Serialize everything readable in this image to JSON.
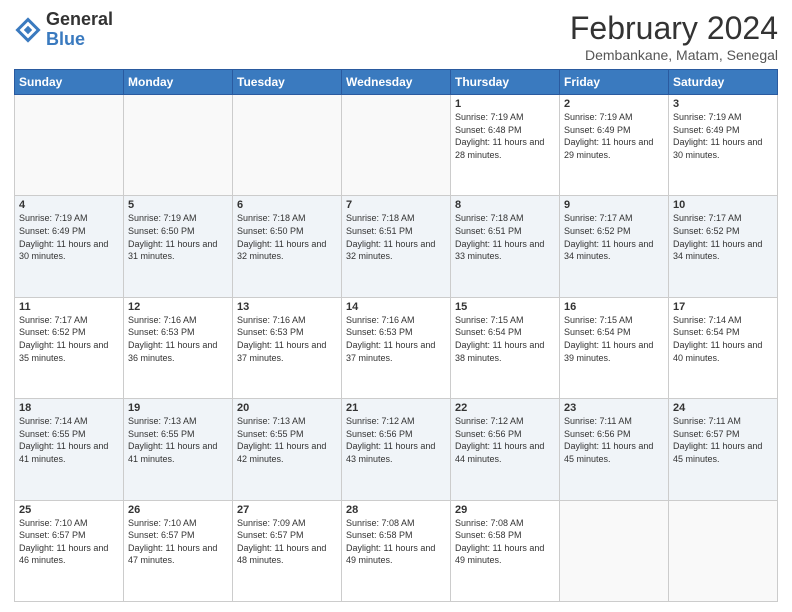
{
  "logo": {
    "general": "General",
    "blue": "Blue"
  },
  "header": {
    "month_title": "February 2024",
    "location": "Dembankane, Matam, Senegal"
  },
  "days_of_week": [
    "Sunday",
    "Monday",
    "Tuesday",
    "Wednesday",
    "Thursday",
    "Friday",
    "Saturday"
  ],
  "weeks": [
    [
      {
        "day": "",
        "info": ""
      },
      {
        "day": "",
        "info": ""
      },
      {
        "day": "",
        "info": ""
      },
      {
        "day": "",
        "info": ""
      },
      {
        "day": "1",
        "info": "Sunrise: 7:19 AM\nSunset: 6:48 PM\nDaylight: 11 hours and 28 minutes."
      },
      {
        "day": "2",
        "info": "Sunrise: 7:19 AM\nSunset: 6:49 PM\nDaylight: 11 hours and 29 minutes."
      },
      {
        "day": "3",
        "info": "Sunrise: 7:19 AM\nSunset: 6:49 PM\nDaylight: 11 hours and 30 minutes."
      }
    ],
    [
      {
        "day": "4",
        "info": "Sunrise: 7:19 AM\nSunset: 6:49 PM\nDaylight: 11 hours and 30 minutes."
      },
      {
        "day": "5",
        "info": "Sunrise: 7:19 AM\nSunset: 6:50 PM\nDaylight: 11 hours and 31 minutes."
      },
      {
        "day": "6",
        "info": "Sunrise: 7:18 AM\nSunset: 6:50 PM\nDaylight: 11 hours and 32 minutes."
      },
      {
        "day": "7",
        "info": "Sunrise: 7:18 AM\nSunset: 6:51 PM\nDaylight: 11 hours and 32 minutes."
      },
      {
        "day": "8",
        "info": "Sunrise: 7:18 AM\nSunset: 6:51 PM\nDaylight: 11 hours and 33 minutes."
      },
      {
        "day": "9",
        "info": "Sunrise: 7:17 AM\nSunset: 6:52 PM\nDaylight: 11 hours and 34 minutes."
      },
      {
        "day": "10",
        "info": "Sunrise: 7:17 AM\nSunset: 6:52 PM\nDaylight: 11 hours and 34 minutes."
      }
    ],
    [
      {
        "day": "11",
        "info": "Sunrise: 7:17 AM\nSunset: 6:52 PM\nDaylight: 11 hours and 35 minutes."
      },
      {
        "day": "12",
        "info": "Sunrise: 7:16 AM\nSunset: 6:53 PM\nDaylight: 11 hours and 36 minutes."
      },
      {
        "day": "13",
        "info": "Sunrise: 7:16 AM\nSunset: 6:53 PM\nDaylight: 11 hours and 37 minutes."
      },
      {
        "day": "14",
        "info": "Sunrise: 7:16 AM\nSunset: 6:53 PM\nDaylight: 11 hours and 37 minutes."
      },
      {
        "day": "15",
        "info": "Sunrise: 7:15 AM\nSunset: 6:54 PM\nDaylight: 11 hours and 38 minutes."
      },
      {
        "day": "16",
        "info": "Sunrise: 7:15 AM\nSunset: 6:54 PM\nDaylight: 11 hours and 39 minutes."
      },
      {
        "day": "17",
        "info": "Sunrise: 7:14 AM\nSunset: 6:54 PM\nDaylight: 11 hours and 40 minutes."
      }
    ],
    [
      {
        "day": "18",
        "info": "Sunrise: 7:14 AM\nSunset: 6:55 PM\nDaylight: 11 hours and 41 minutes."
      },
      {
        "day": "19",
        "info": "Sunrise: 7:13 AM\nSunset: 6:55 PM\nDaylight: 11 hours and 41 minutes."
      },
      {
        "day": "20",
        "info": "Sunrise: 7:13 AM\nSunset: 6:55 PM\nDaylight: 11 hours and 42 minutes."
      },
      {
        "day": "21",
        "info": "Sunrise: 7:12 AM\nSunset: 6:56 PM\nDaylight: 11 hours and 43 minutes."
      },
      {
        "day": "22",
        "info": "Sunrise: 7:12 AM\nSunset: 6:56 PM\nDaylight: 11 hours and 44 minutes."
      },
      {
        "day": "23",
        "info": "Sunrise: 7:11 AM\nSunset: 6:56 PM\nDaylight: 11 hours and 45 minutes."
      },
      {
        "day": "24",
        "info": "Sunrise: 7:11 AM\nSunset: 6:57 PM\nDaylight: 11 hours and 45 minutes."
      }
    ],
    [
      {
        "day": "25",
        "info": "Sunrise: 7:10 AM\nSunset: 6:57 PM\nDaylight: 11 hours and 46 minutes."
      },
      {
        "day": "26",
        "info": "Sunrise: 7:10 AM\nSunset: 6:57 PM\nDaylight: 11 hours and 47 minutes."
      },
      {
        "day": "27",
        "info": "Sunrise: 7:09 AM\nSunset: 6:57 PM\nDaylight: 11 hours and 48 minutes."
      },
      {
        "day": "28",
        "info": "Sunrise: 7:08 AM\nSunset: 6:58 PM\nDaylight: 11 hours and 49 minutes."
      },
      {
        "day": "29",
        "info": "Sunrise: 7:08 AM\nSunset: 6:58 PM\nDaylight: 11 hours and 49 minutes."
      },
      {
        "day": "",
        "info": ""
      },
      {
        "day": "",
        "info": ""
      }
    ]
  ]
}
